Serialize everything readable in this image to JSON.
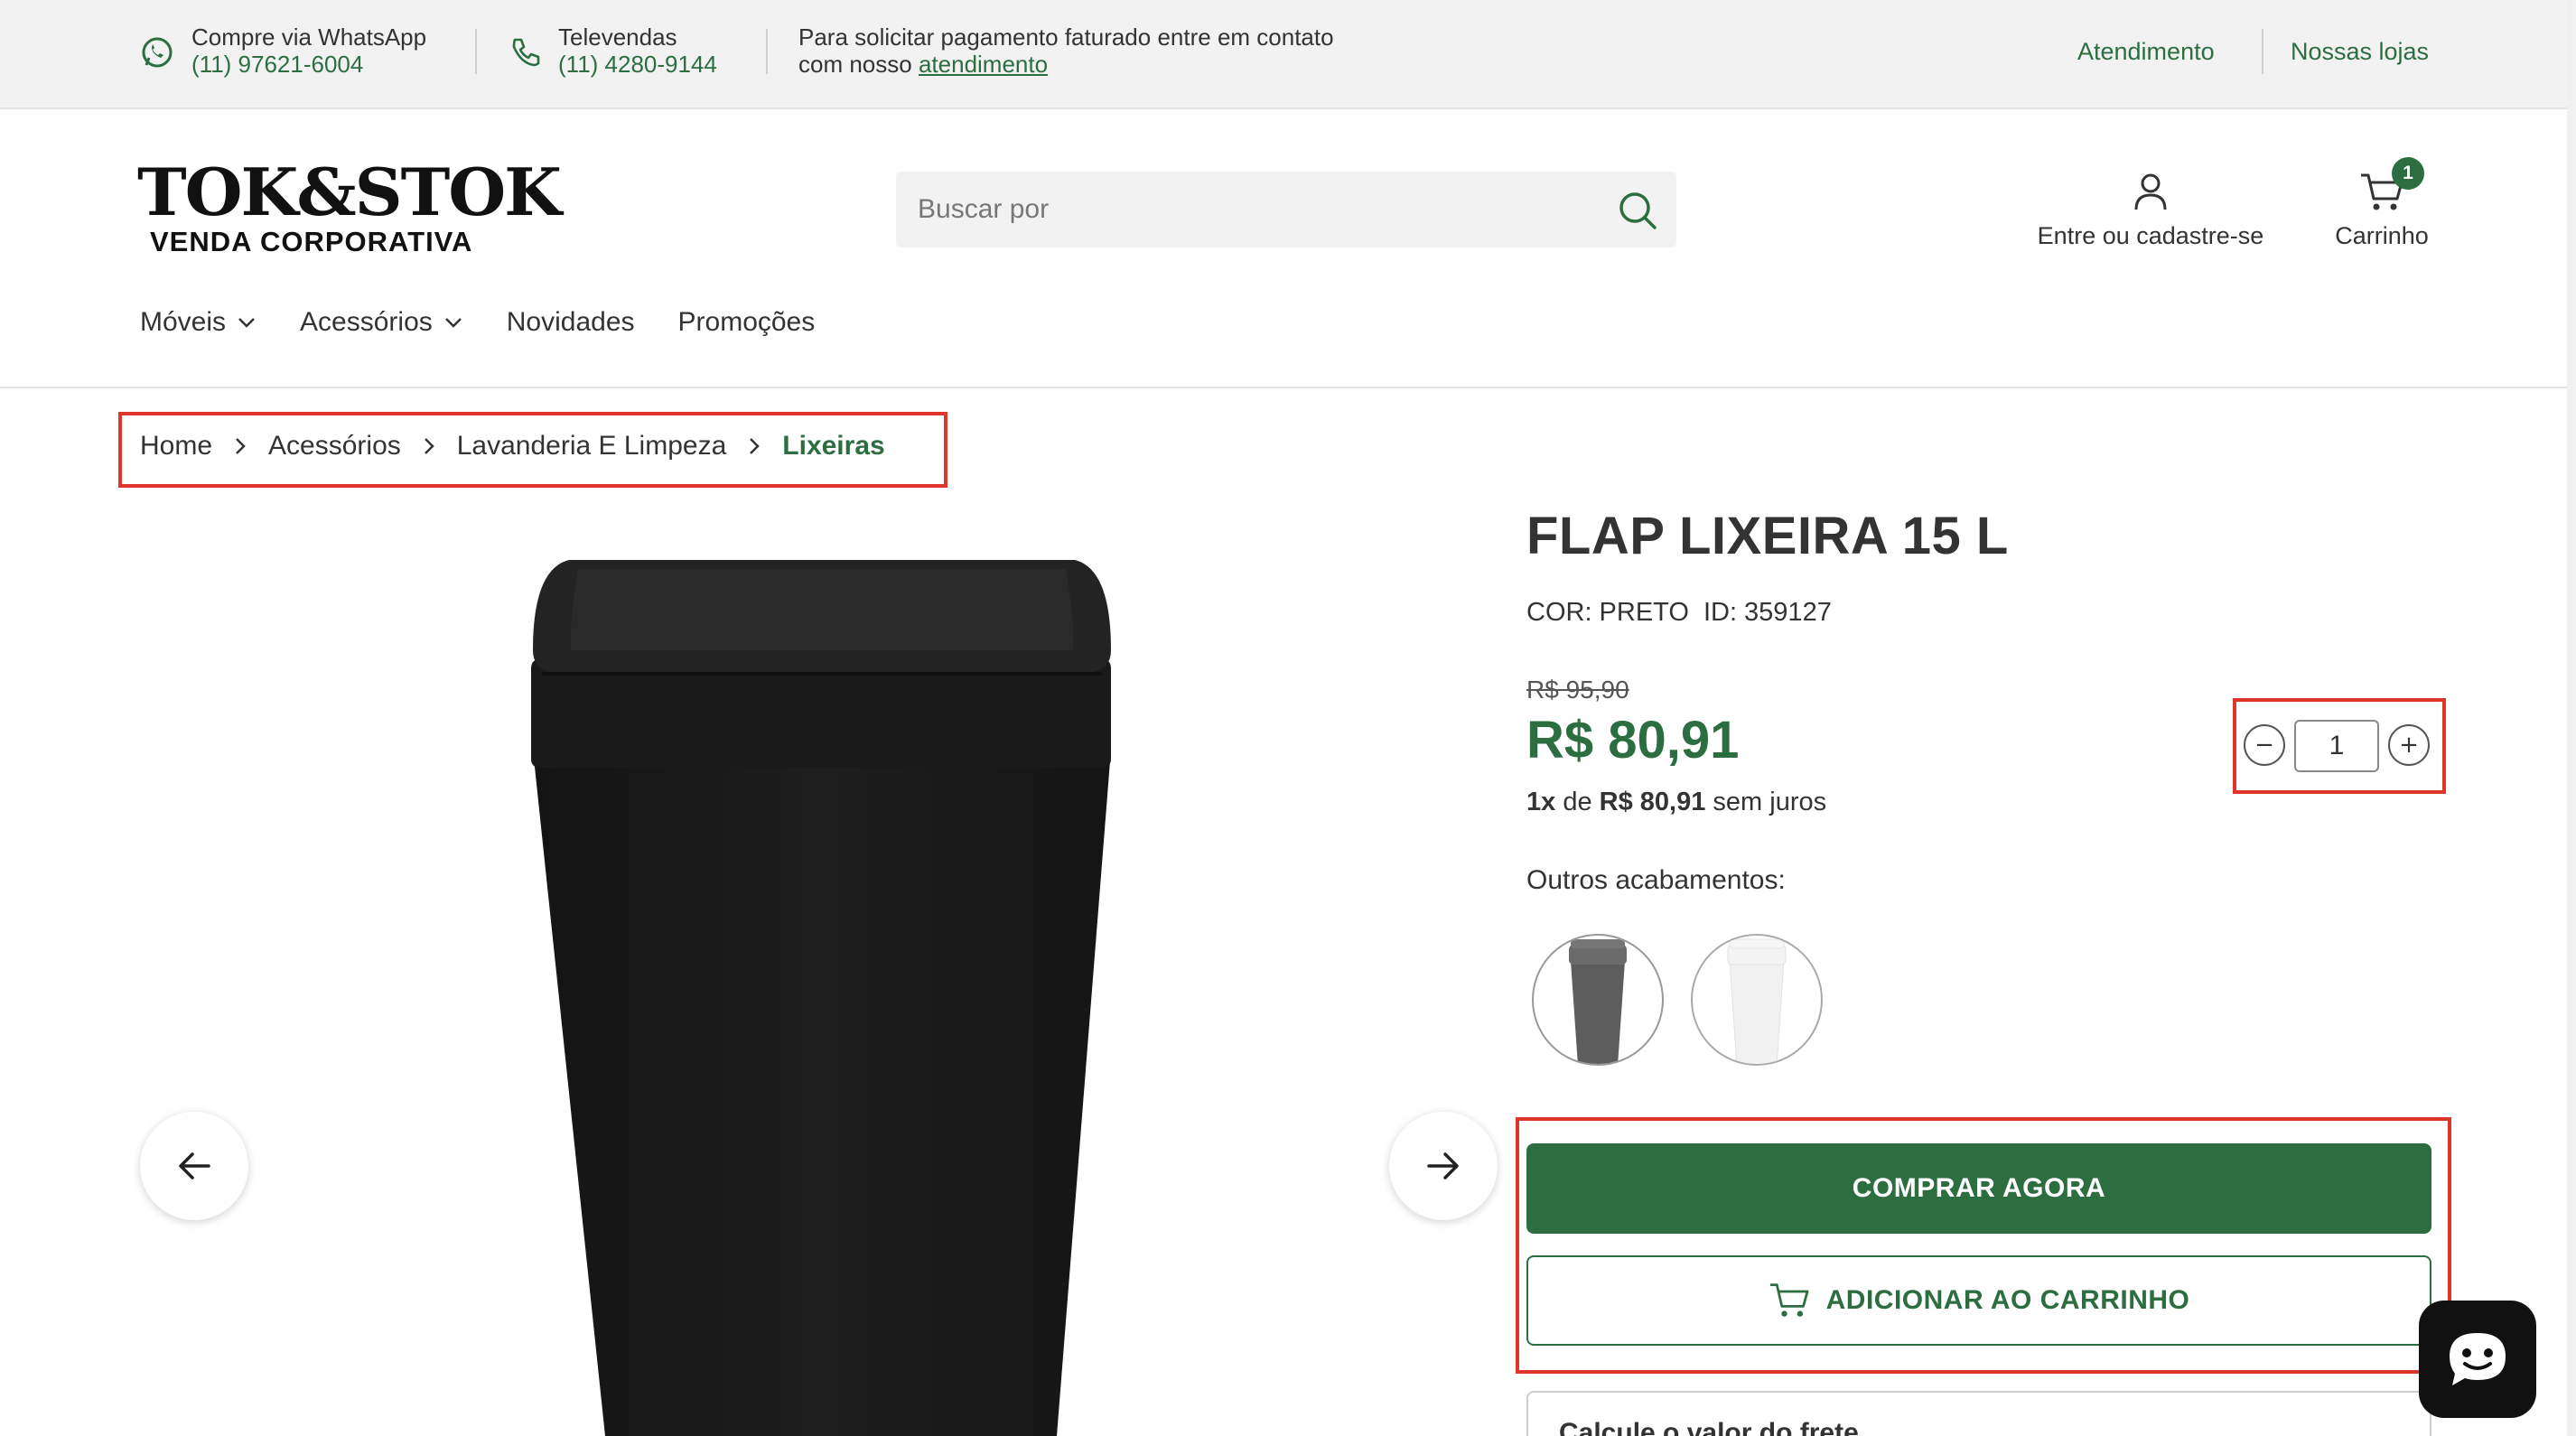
{
  "topbar": {
    "whatsapp_label": "Compre via WhatsApp",
    "whatsapp_number": "(11) 97621-6004",
    "televendas_label": "Televendas",
    "televendas_number": "(11) 4280-9144",
    "note_text": "Para solicitar pagamento faturado entre em contato com nosso",
    "note_link": "atendimento",
    "link_atendimento": "Atendimento",
    "link_lojas": "Nossas lojas"
  },
  "header": {
    "logo_main": "TOK&STOK",
    "logo_sub": "VENDA CORPORATIVA",
    "search_placeholder": "Buscar por",
    "account_label": "Entre ou cadastre-se",
    "cart_label": "Carrinho",
    "cart_count": "1"
  },
  "nav": {
    "items": [
      {
        "label": "Móveis",
        "dropdown": true
      },
      {
        "label": "Acessórios",
        "dropdown": true
      },
      {
        "label": "Novidades",
        "dropdown": false
      },
      {
        "label": "Promoções",
        "dropdown": false
      }
    ]
  },
  "breadcrumb": [
    "Home",
    "Acessórios",
    "Lavanderia E Limpeza",
    "Lixeiras"
  ],
  "product": {
    "title": "FLAP LIXEIRA 15 L",
    "color": "COR: PRETO",
    "id": "ID: 359127",
    "old_price": "R$ 95,90",
    "price": "R$ 80,91",
    "installments_count": "1x",
    "installments_of": "de",
    "installments_value": "R$ 80,91",
    "installments_suffix": "sem juros",
    "quantity": "1",
    "finishes_label": "Outros acabamentos:",
    "buy_now": "COMPRAR AGORA",
    "add_to_cart": "ADICIONAR AO CARRINHO",
    "freight_label": "Calcule o valor do frete"
  },
  "colors": {
    "brand_green": "#2c6e3f",
    "highlight_red": "#e0352b"
  }
}
